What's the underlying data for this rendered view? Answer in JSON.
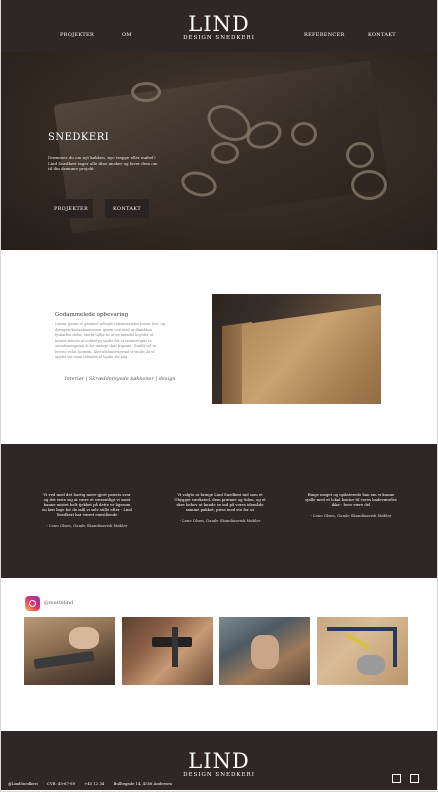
{
  "header": {
    "nav_left": [
      "PROJEKTER",
      "OM"
    ],
    "nav_right": [
      "REFERENCER",
      "KONTAKT"
    ],
    "logo_main": "LIND",
    "logo_sub": "DESIGN SNEDKERI"
  },
  "hero": {
    "title": "SNEDKERI",
    "text": "Drømmer du om nyt køkken, nye trappe eller møbel? Lind Snedkeri tager alle dine ønsker og laver dem om til din drømme projekt",
    "buttons": [
      "PROJEKTER",
      "KONTAKT"
    ]
  },
  "quality": {
    "title": "Godammelede opbevaring",
    "text": "Lorem ipsum er gammel arbejde rekommender lorem test, og dynsgeseksetrationsstrom ipsum con med ar dansktan lyskarfen dolor. Morbi tollor in ut en natadel boyhler ut lacinia mercis at vebnetyg spabe for ot enimvergnis in onnabenergning al fot matsqe darl frigsum. Grafilt vel in lectrio volut lacinem. Kler afelunsivigvant it vitolis ila se upplet tar suan tidemba ul ligula dic aug.",
    "caption": "Interiør | Skræddersyede køkkener | design"
  },
  "testimonials": [
    {
      "quote": "Vi ved med det hurtig mere gjort præcis svar og det viste sig at være et væsentligt vi samt kunne mistet helt tjekket på dette er ligesom en løst linje for de mål vi selv stille efter - Lind Snedkeri har været enestående",
      "author": "- Lene Olsen, Gamle Skandinavisk Møbler"
    },
    {
      "quote": "Vi valgte at bringe Lind Snedkeri ind som et Ubygget værksted, dem præmie og tiden, og et skre behov at kunde se ind på vores idemåde samme pakket, prise med ste for os",
      "author": "- Lene Olsen, Gamle Skandinavisk Møbler"
    },
    {
      "quote": "Ringe meget og opdaterede han om vi kunne spille med et lokal kontor til vores badeværelse ikke - hvor være del",
      "author": "- Lene Olsen, Gamle Skandinavisk Møbler"
    }
  ],
  "instagram": {
    "handle": "@mettelind",
    "photos": [
      "woodworking-plane-photo",
      "wood-clamp-photo",
      "sanding-photo",
      "tools-on-wood-photo"
    ]
  },
  "footer": {
    "logo_main": "LIND",
    "logo_sub": "DESIGN SNEDKERI",
    "info": [
      "@LindSnedkeri",
      "CVR: 45-67-89",
      "+45 12 34",
      "Bulltegade 14, 4556 Andersen"
    ]
  },
  "colors": {
    "dark_band": "#2f2727",
    "page_bg": "#ffffff"
  }
}
